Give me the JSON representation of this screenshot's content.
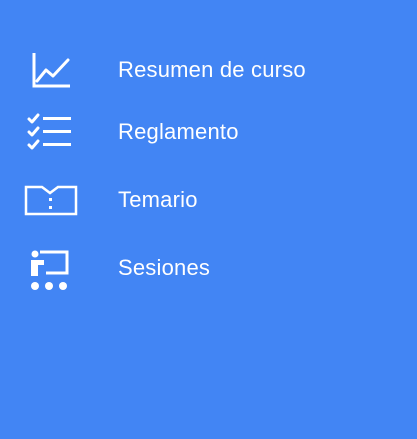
{
  "theme": {
    "background": "#4285f4",
    "foreground": "#ffffff"
  },
  "menu": {
    "items": [
      {
        "label": "Resumen de curso",
        "icon": "chart-line-icon"
      },
      {
        "label": "Reglamento",
        "icon": "checklist-icon"
      },
      {
        "label": "Temario",
        "icon": "open-book-icon"
      },
      {
        "label": "Sesiones",
        "icon": "presentation-icon"
      }
    ]
  }
}
